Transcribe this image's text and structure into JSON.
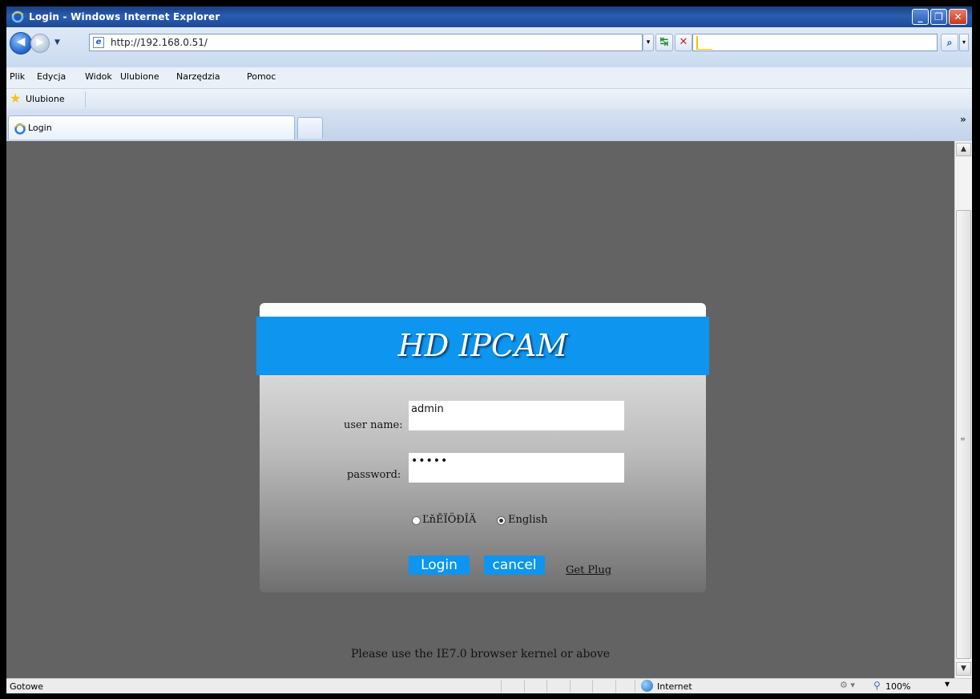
{
  "window": {
    "title": "Login - Windows Internet Explorer",
    "minimize": "_",
    "maximize": "❐",
    "close": "✕"
  },
  "address": {
    "url": "http://192.168.0.51/",
    "dropdown": "▾"
  },
  "toolbar": {
    "refresh": "↹",
    "stop": "✕",
    "search_icon": "search-icon",
    "search_button": "⌕",
    "overflow": "»"
  },
  "menu": [
    "Plik",
    "Edycja",
    "Widok",
    "Ulubione",
    "Narzędzia",
    "Pomoc"
  ],
  "favorites": {
    "label": "Ulubione"
  },
  "tabs": [
    {
      "label": "Login"
    }
  ],
  "login": {
    "brand": "HD IPCAM",
    "username_label": "user name:",
    "username_value": "admin",
    "password_label": "password:",
    "password_value": "•••••",
    "lang_option_1": "ĽňĚÏÖĐÎÄ",
    "lang_option_2": "English",
    "selected_language": "English",
    "login_button": "Login",
    "cancel_button": "cancel",
    "get_plug": "Get Plug",
    "notice": "Please use the IE7.0 browser kernel or above"
  },
  "status": {
    "text": "Gotowe",
    "zone": "Internet",
    "zoom": "100%"
  },
  "colors": {
    "banner": "#0d95ef",
    "page_background": "#636363",
    "button": "#0d95ef"
  }
}
